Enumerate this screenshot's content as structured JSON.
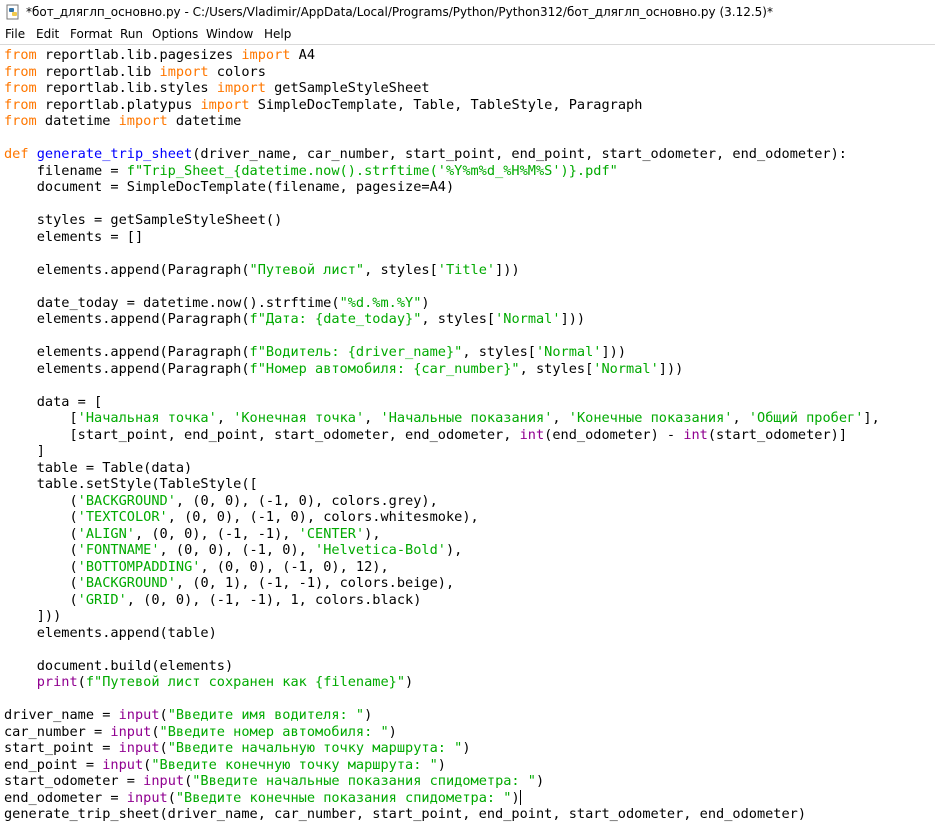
{
  "window": {
    "title": "*бот_дляглп_основно.py - C:/Users/Vladimir/AppData/Local/Programs/Python/Python312/бот_дляглп_основно.py (3.12.5)*"
  },
  "menu": {
    "items": [
      "File",
      "Edit",
      "Format",
      "Run",
      "Options",
      "Window",
      "Help"
    ]
  },
  "editor": {
    "lines": [
      [
        {
          "t": "from",
          "c": "kw"
        },
        {
          "t": " reportlab.lib.pagesizes "
        },
        {
          "t": "import",
          "c": "kw"
        },
        {
          "t": " A4"
        }
      ],
      [
        {
          "t": "from",
          "c": "kw"
        },
        {
          "t": " reportlab.lib "
        },
        {
          "t": "import",
          "c": "kw"
        },
        {
          "t": " colors"
        }
      ],
      [
        {
          "t": "from",
          "c": "kw"
        },
        {
          "t": " reportlab.lib.styles "
        },
        {
          "t": "import",
          "c": "kw"
        },
        {
          "t": " getSampleStyleSheet"
        }
      ],
      [
        {
          "t": "from",
          "c": "kw"
        },
        {
          "t": " reportlab.platypus "
        },
        {
          "t": "import",
          "c": "kw"
        },
        {
          "t": " SimpleDocTemplate, Table, TableStyle, Paragraph"
        }
      ],
      [
        {
          "t": "from",
          "c": "kw"
        },
        {
          "t": " datetime "
        },
        {
          "t": "import",
          "c": "kw"
        },
        {
          "t": " datetime"
        }
      ],
      [],
      [
        {
          "t": "def",
          "c": "kw"
        },
        {
          "t": " "
        },
        {
          "t": "generate_trip_sheet",
          "c": "def"
        },
        {
          "t": "(driver_name, car_number, start_point, end_point, start_odometer, end_odometer):"
        }
      ],
      [
        {
          "t": "    filename = "
        },
        {
          "t": "f\"Trip_Sheet_{datetime.now().strftime('%Y%m%d_%H%M%S')}.pdf\"",
          "c": "str"
        }
      ],
      [
        {
          "t": "    document = SimpleDocTemplate(filename, pagesize=A4)"
        }
      ],
      [],
      [
        {
          "t": "    styles = getSampleStyleSheet()"
        }
      ],
      [
        {
          "t": "    elements = []"
        }
      ],
      [],
      [
        {
          "t": "    elements.append(Paragraph("
        },
        {
          "t": "\"Путевой лист\"",
          "c": "str"
        },
        {
          "t": ", styles["
        },
        {
          "t": "'Title'",
          "c": "str"
        },
        {
          "t": "]))"
        }
      ],
      [],
      [
        {
          "t": "    date_today = datetime.now().strftime("
        },
        {
          "t": "\"%d.%m.%Y\"",
          "c": "str"
        },
        {
          "t": ")"
        }
      ],
      [
        {
          "t": "    elements.append(Paragraph("
        },
        {
          "t": "f\"Дата: {date_today}\"",
          "c": "str"
        },
        {
          "t": ", styles["
        },
        {
          "t": "'Normal'",
          "c": "str"
        },
        {
          "t": "]))"
        }
      ],
      [],
      [
        {
          "t": "    elements.append(Paragraph("
        },
        {
          "t": "f\"Водитель: {driver_name}\"",
          "c": "str"
        },
        {
          "t": ", styles["
        },
        {
          "t": "'Normal'",
          "c": "str"
        },
        {
          "t": "]))"
        }
      ],
      [
        {
          "t": "    elements.append(Paragraph("
        },
        {
          "t": "f\"Номер автомобиля: {car_number}\"",
          "c": "str"
        },
        {
          "t": ", styles["
        },
        {
          "t": "'Normal'",
          "c": "str"
        },
        {
          "t": "]))"
        }
      ],
      [],
      [
        {
          "t": "    data = ["
        }
      ],
      [
        {
          "t": "        ["
        },
        {
          "t": "'Начальная точка'",
          "c": "str"
        },
        {
          "t": ", "
        },
        {
          "t": "'Конечная точка'",
          "c": "str"
        },
        {
          "t": ", "
        },
        {
          "t": "'Начальные показания'",
          "c": "str"
        },
        {
          "t": ", "
        },
        {
          "t": "'Конечные показания'",
          "c": "str"
        },
        {
          "t": ", "
        },
        {
          "t": "'Общий пробег'",
          "c": "str"
        },
        {
          "t": "],"
        }
      ],
      [
        {
          "t": "        [start_point, end_point, start_odometer, end_odometer, "
        },
        {
          "t": "int",
          "c": "bi"
        },
        {
          "t": "(end_odometer) - "
        },
        {
          "t": "int",
          "c": "bi"
        },
        {
          "t": "(start_odometer)]"
        }
      ],
      [
        {
          "t": "    ]"
        }
      ],
      [
        {
          "t": "    table = Table(data)"
        }
      ],
      [
        {
          "t": "    table.setStyle(TableStyle(["
        }
      ],
      [
        {
          "t": "        ("
        },
        {
          "t": "'BACKGROUND'",
          "c": "str"
        },
        {
          "t": ", (0, 0), (-1, 0), colors.grey),"
        }
      ],
      [
        {
          "t": "        ("
        },
        {
          "t": "'TEXTCOLOR'",
          "c": "str"
        },
        {
          "t": ", (0, 0), (-1, 0), colors.whitesmoke),"
        }
      ],
      [
        {
          "t": "        ("
        },
        {
          "t": "'ALIGN'",
          "c": "str"
        },
        {
          "t": ", (0, 0), (-1, -1), "
        },
        {
          "t": "'CENTER'",
          "c": "str"
        },
        {
          "t": "),"
        }
      ],
      [
        {
          "t": "        ("
        },
        {
          "t": "'FONTNAME'",
          "c": "str"
        },
        {
          "t": ", (0, 0), (-1, 0), "
        },
        {
          "t": "'Helvetica-Bold'",
          "c": "str"
        },
        {
          "t": "),"
        }
      ],
      [
        {
          "t": "        ("
        },
        {
          "t": "'BOTTOMPADDING'",
          "c": "str"
        },
        {
          "t": ", (0, 0), (-1, 0), 12),"
        }
      ],
      [
        {
          "t": "        ("
        },
        {
          "t": "'BACKGROUND'",
          "c": "str"
        },
        {
          "t": ", (0, 1), (-1, -1), colors.beige),"
        }
      ],
      [
        {
          "t": "        ("
        },
        {
          "t": "'GRID'",
          "c": "str"
        },
        {
          "t": ", (0, 0), (-1, -1), 1, colors.black)"
        }
      ],
      [
        {
          "t": "    ]))"
        }
      ],
      [
        {
          "t": "    elements.append(table)"
        }
      ],
      [],
      [
        {
          "t": "    document.build(elements)"
        }
      ],
      [
        {
          "t": "    "
        },
        {
          "t": "print",
          "c": "bi"
        },
        {
          "t": "("
        },
        {
          "t": "f\"Путевой лист сохранен как {filename}\"",
          "c": "str"
        },
        {
          "t": ")"
        }
      ],
      [],
      [
        {
          "t": "driver_name = "
        },
        {
          "t": "input",
          "c": "bi"
        },
        {
          "t": "("
        },
        {
          "t": "\"Введите имя водителя: \"",
          "c": "str"
        },
        {
          "t": ")"
        }
      ],
      [
        {
          "t": "car_number = "
        },
        {
          "t": "input",
          "c": "bi"
        },
        {
          "t": "("
        },
        {
          "t": "\"Введите номер автомобиля: \"",
          "c": "str"
        },
        {
          "t": ")"
        }
      ],
      [
        {
          "t": "start_point = "
        },
        {
          "t": "input",
          "c": "bi"
        },
        {
          "t": "("
        },
        {
          "t": "\"Введите начальную точку маршрута: \"",
          "c": "str"
        },
        {
          "t": ")"
        }
      ],
      [
        {
          "t": "end_point = "
        },
        {
          "t": "input",
          "c": "bi"
        },
        {
          "t": "("
        },
        {
          "t": "\"Введите конечную точку маршрута: \"",
          "c": "str"
        },
        {
          "t": ")"
        }
      ],
      [
        {
          "t": "start_odometer = "
        },
        {
          "t": "input",
          "c": "bi"
        },
        {
          "t": "("
        },
        {
          "t": "\"Введите начальные показания спидометра: \"",
          "c": "str"
        },
        {
          "t": ")"
        }
      ],
      [
        {
          "t": "end_odometer = "
        },
        {
          "t": "input",
          "c": "bi"
        },
        {
          "t": "("
        },
        {
          "t": "\"Введите конечные показания спидометра: \"",
          "c": "str"
        },
        {
          "t": ")"
        },
        {
          "caret": true
        }
      ],
      [
        {
          "t": "generate_trip_sheet(driver_name, car_number, start_point, end_point, start_odometer, end_odometer)"
        }
      ]
    ]
  },
  "colors": {
    "keyword": "#ff7700",
    "definition": "#0000ff",
    "string": "#00aa00",
    "builtin": "#900090"
  },
  "icons": {
    "app": "python-idle-icon"
  }
}
